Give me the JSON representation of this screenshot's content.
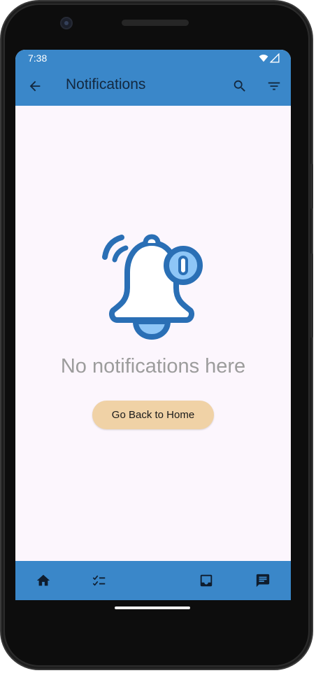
{
  "status_bar": {
    "time": "7:38",
    "icons": [
      "wifi-icon",
      "signal-icon"
    ]
  },
  "app_bar": {
    "title": "Notifications",
    "back_icon": "arrow-back-icon",
    "actions": [
      "search-icon",
      "filter-icon"
    ]
  },
  "empty_state": {
    "illustration": "bell-notification-icon",
    "message": "No notifications here",
    "button_label": "Go Back to Home"
  },
  "bottom_nav": {
    "items": [
      {
        "icon": "home-icon"
      },
      {
        "icon": "checklist-icon"
      },
      {
        "icon": "inbox-icon"
      },
      {
        "icon": "chat-icon"
      }
    ]
  },
  "colors": {
    "app_bar": "#3a87c9",
    "screen_background": "#fcf6fd",
    "button_background": "#f0d2a6",
    "bell_stroke": "#2a6fb5",
    "bell_accent": "#8ec6f7",
    "muted_text": "#9c9c9c"
  }
}
